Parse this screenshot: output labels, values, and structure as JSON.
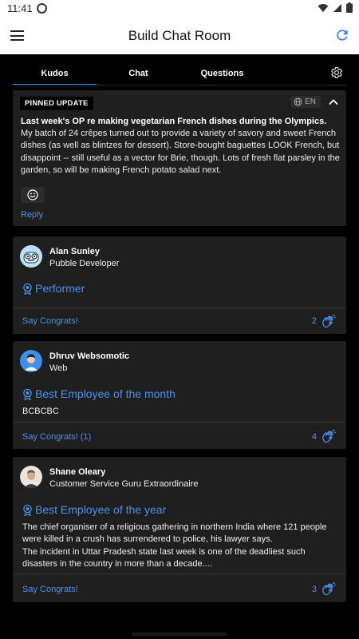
{
  "status_bar": {
    "time": "11:41"
  },
  "app_bar": {
    "title": "Build Chat Room"
  },
  "tabs": [
    {
      "label": "Kudos",
      "active": true
    },
    {
      "label": "Chat",
      "active": false
    },
    {
      "label": "Questions",
      "active": false
    }
  ],
  "pinned": {
    "badge": "PINNED UPDATE",
    "language": "EN",
    "title": "Last week's OP re making vegetarian French dishes during the Olympics.",
    "body": "My batch of 24 crêpes turned out to provide a variety of savory and sweet French dishes (as well as blintzes for dessert). Store-bought baguettes LOOK French, but disappoint -- still useful as a vector for Brie, though. Lots of fresh flat parsley in the garden, so will be making French potato salad next.",
    "reply_label": "Reply"
  },
  "kudos": [
    {
      "name": "Alan Sunley",
      "role": "Pubble Developer",
      "award": "Performer",
      "message": "",
      "congrats_label": "Say Congrats!",
      "count": "2"
    },
    {
      "name": "Dhruv Websomotic",
      "role": "Web",
      "award": "Best Employee of the month",
      "message": "BCBCBC",
      "congrats_label": "Say Congrats! (1)",
      "count": "4"
    },
    {
      "name": "Shane Oleary",
      "role": "Customer Service Guru Extraordinaire",
      "award": "Best Employee of the year",
      "message": "The chief organiser of a religious gathering in northern India where 121 people were killed in a crush has surrendered to police, his lawyer says.\nThe incident in Uttar Pradesh state last week is one of the deadliest such disasters in the country in more than a decade....",
      "congrats_label": "Say Congrats!",
      "count": "3"
    }
  ],
  "colors": {
    "accent": "#2f80ed",
    "link": "#4a8ff0",
    "card": "#1f1f1f",
    "background": "#000000"
  }
}
